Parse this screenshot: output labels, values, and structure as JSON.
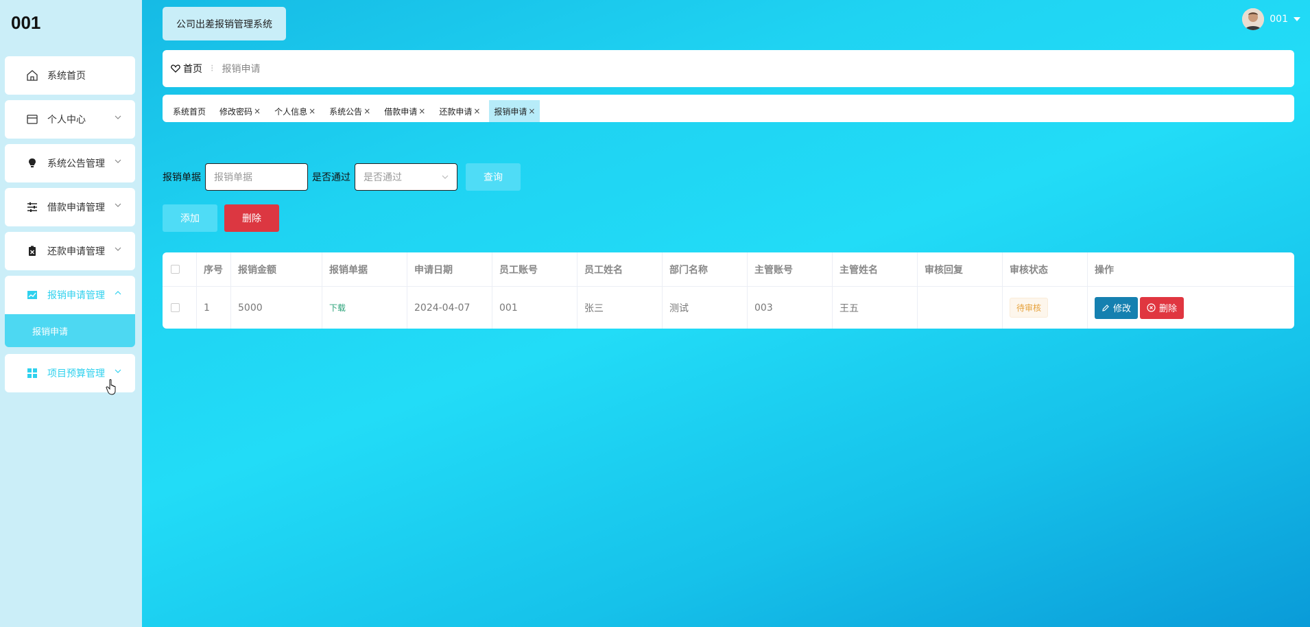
{
  "sidebar": {
    "logo": "001",
    "items": [
      {
        "label": "系统首页",
        "icon": "home-icon"
      },
      {
        "label": "个人中心",
        "icon": "card-icon"
      },
      {
        "label": "系统公告管理",
        "icon": "bulb-icon"
      },
      {
        "label": "借款申请管理",
        "icon": "sliders-icon"
      },
      {
        "label": "还款申请管理",
        "icon": "clipboard-x-icon"
      },
      {
        "label": "报销申请管理",
        "icon": "chart-icon"
      },
      {
        "label": "项目预算管理",
        "icon": "grid-icon"
      }
    ],
    "submenu": {
      "label": "报销申请"
    }
  },
  "header": {
    "system_title": "公司出差报销管理系统",
    "user_name": "001"
  },
  "breadcrumb": {
    "home": "首页",
    "current": "报销申请"
  },
  "tabs": [
    {
      "label": "系统首页"
    },
    {
      "label": "修改密码"
    },
    {
      "label": "个人信息"
    },
    {
      "label": "系统公告"
    },
    {
      "label": "借款申请"
    },
    {
      "label": "还款申请"
    },
    {
      "label": "报销申请"
    }
  ],
  "search": {
    "doc_label": "报销单据",
    "doc_placeholder": "报销单据",
    "pass_label": "是否通过",
    "pass_placeholder": "是否通过",
    "query_button": "查询"
  },
  "actions": {
    "add": "添加",
    "delete": "删除"
  },
  "table": {
    "headers": [
      "序号",
      "报销金额",
      "报销单据",
      "申请日期",
      "员工账号",
      "员工姓名",
      "部门名称",
      "主管账号",
      "主管姓名",
      "审核回复",
      "审核状态",
      "操作"
    ],
    "rows": [
      {
        "index": "1",
        "amount": "5000",
        "document": "下载",
        "date": "2024-04-07",
        "emp_account": "001",
        "emp_name": "张三",
        "dept": "测试",
        "mgr_account": "003",
        "mgr_name": "王五",
        "reply": "",
        "status": "待审核",
        "edit": "修改",
        "remove": "删除"
      }
    ]
  },
  "colors": {
    "accent": "#4fdcf6",
    "danger": "#dc3741",
    "edit": "#1580b0",
    "sidebar_bg": "#cbeef8"
  }
}
